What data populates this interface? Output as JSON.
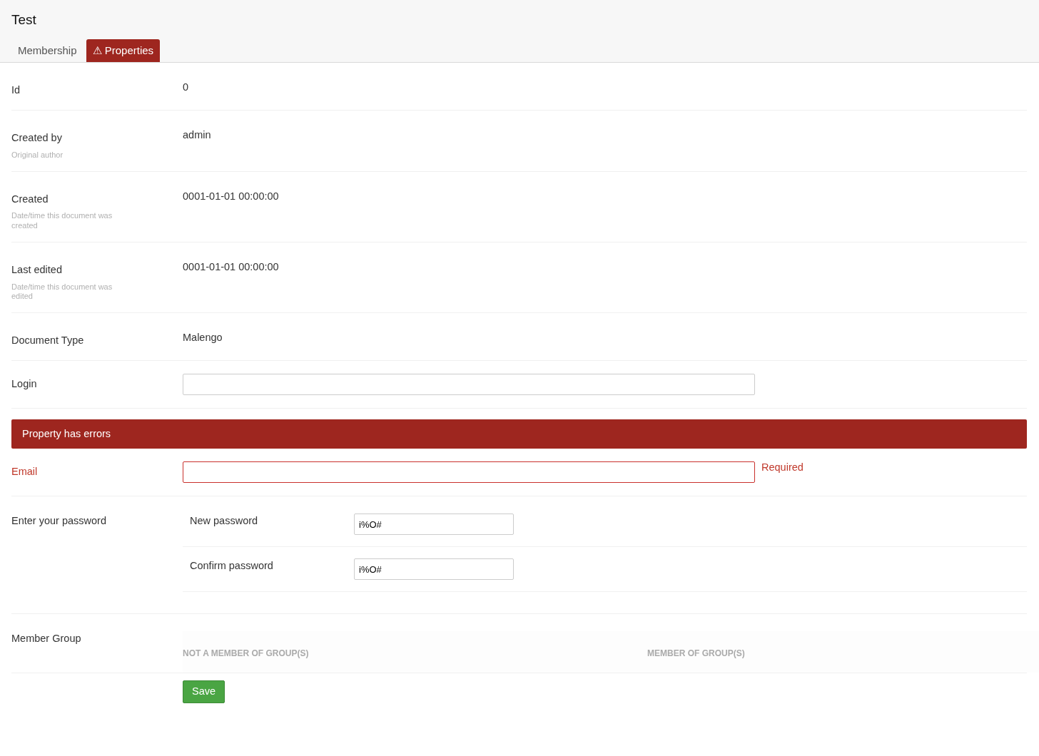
{
  "title": "Test",
  "tabs": [
    {
      "label": "Membership",
      "selected": false
    },
    {
      "label": "Properties",
      "selected": true,
      "icon": "⚠"
    }
  ],
  "properties": [
    {
      "kind": "text",
      "label": "Id",
      "value": "0"
    },
    {
      "kind": "text",
      "label": "Created by",
      "description": "Original author",
      "value": "admin"
    },
    {
      "kind": "text",
      "label": "Created",
      "description": "Date/time this document was created",
      "value": "0001-01-01 00:00:00"
    },
    {
      "kind": "text",
      "label": "Last edited",
      "description": "Date/time this document was edited",
      "value": "0001-01-01 00:00:00"
    },
    {
      "kind": "text",
      "label": "Document Type",
      "value": "Malengo"
    },
    {
      "kind": "input",
      "label": "Login",
      "error": false
    },
    {
      "kind": "input",
      "label": "Email",
      "error": true,
      "error_banner": "Property has errors",
      "error_message": "Required"
    },
    {
      "kind": "password",
      "label": "Enter your password",
      "fields": [
        {
          "label": "New password",
          "value": "i%O#"
        },
        {
          "label": "Confirm password",
          "value": "i%O#"
        }
      ]
    },
    {
      "kind": "groups",
      "label": "Member Group",
      "columns": [
        "NOT A MEMBER OF GROUP(S)",
        "MEMBER OF GROUP(S)"
      ]
    }
  ],
  "save_button": "Save"
}
